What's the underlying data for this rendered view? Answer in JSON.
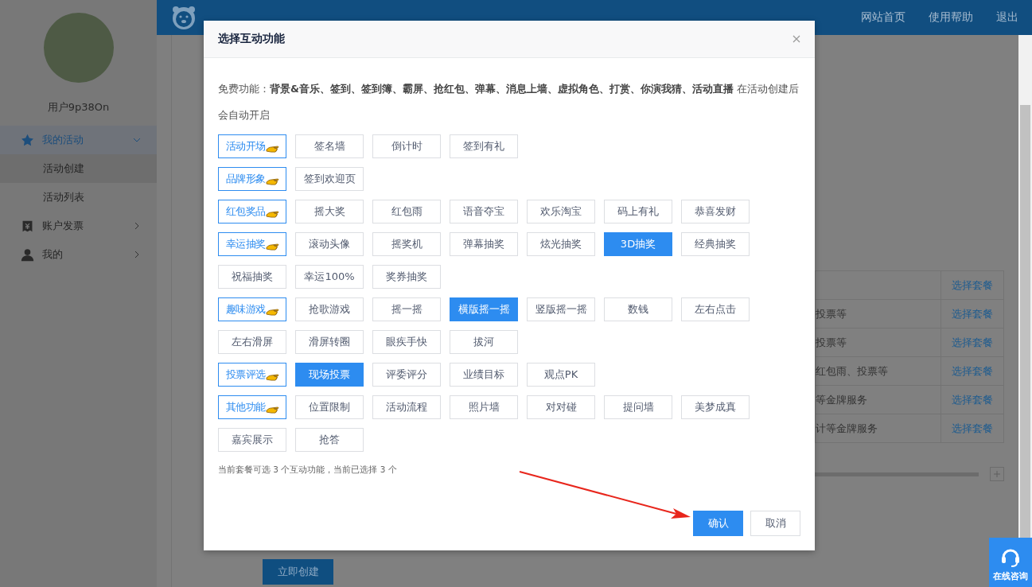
{
  "sidebar": {
    "user_name": "用户9p38On",
    "menu": [
      {
        "label": "我的活动",
        "expanded": true,
        "selected": true,
        "children": [
          {
            "label": "活动创建",
            "selected": true
          },
          {
            "label": "活动列表",
            "selected": false
          }
        ]
      },
      {
        "label": "账户发票",
        "expanded": false,
        "selected": false
      },
      {
        "label": "我的",
        "expanded": false,
        "selected": false
      }
    ]
  },
  "header": {
    "links": [
      "网站首页",
      "使用帮助",
      "退出"
    ]
  },
  "background_table": {
    "rows": [
      {
        "action": "选择套餐"
      },
      {
        "column_1": "投票等",
        "action": "选择套餐"
      },
      {
        "column_1": "投票等",
        "action": "选择套餐"
      },
      {
        "column_1": "红包雨、投票等",
        "action": "选择套餐"
      },
      {
        "column_1": "等金牌服务",
        "action": "选择套餐"
      },
      {
        "column_1": "计等金牌服务",
        "action": "选择套餐"
      }
    ]
  },
  "create_button": "立即创建",
  "dialog": {
    "title": "选择互动功能",
    "free_note": "免费功能：**背景&音乐、签到、签到簿、霸屏、抢红包、弹幕、消息上墙、虚拟角色、打赏、你演我猜、活动直播** 在活动创建后会自动开启",
    "groups": [
      {
        "label": "活动开场",
        "items": [
          {
            "label": "签名墙",
            "selected": false
          },
          {
            "label": "倒计时",
            "selected": false
          },
          {
            "label": "签到有礼",
            "selected": false
          }
        ]
      },
      {
        "label": "品牌形象",
        "items": [
          {
            "label": "签到欢迎页",
            "selected": false
          }
        ]
      },
      {
        "label": "红包奖品",
        "items": [
          {
            "label": "摇大奖",
            "selected": false
          },
          {
            "label": "红包雨",
            "selected": false
          },
          {
            "label": "语音夺宝",
            "selected": false
          },
          {
            "label": "欢乐淘宝",
            "selected": false
          },
          {
            "label": "码上有礼",
            "selected": false
          },
          {
            "label": "恭喜发财",
            "selected": false
          }
        ]
      },
      {
        "label": "幸运抽奖",
        "items": [
          {
            "label": "滚动头像",
            "selected": false
          },
          {
            "label": "摇奖机",
            "selected": false
          },
          {
            "label": "弹幕抽奖",
            "selected": false
          },
          {
            "label": "炫光抽奖",
            "selected": false
          },
          {
            "label": "3D抽奖",
            "selected": true
          },
          {
            "label": "经典抽奖",
            "selected": false
          },
          {
            "label": "祝福抽奖",
            "selected": false
          },
          {
            "label": "幸运100%",
            "selected": false
          },
          {
            "label": "奖券抽奖",
            "selected": false
          }
        ]
      },
      {
        "label": "趣味游戏",
        "items": [
          {
            "label": "抢歌游戏",
            "selected": false
          },
          {
            "label": "摇一摇",
            "selected": false
          },
          {
            "label": "横版摇一摇",
            "selected": true
          },
          {
            "label": "竖版摇一摇",
            "selected": false
          },
          {
            "label": "数钱",
            "selected": false
          },
          {
            "label": "左右点击",
            "selected": false
          },
          {
            "label": "左右滑屏",
            "selected": false
          },
          {
            "label": "滑屏转圈",
            "selected": false
          },
          {
            "label": "眼疾手快",
            "selected": false
          },
          {
            "label": "拔河",
            "selected": false
          }
        ]
      },
      {
        "label": "投票评选",
        "items": [
          {
            "label": "现场投票",
            "selected": true
          },
          {
            "label": "评委评分",
            "selected": false
          },
          {
            "label": "业绩目标",
            "selected": false
          },
          {
            "label": "观点PK",
            "selected": false
          }
        ]
      },
      {
        "label": "其他功能",
        "items": [
          {
            "label": "位置限制",
            "selected": false
          },
          {
            "label": "活动流程",
            "selected": false
          },
          {
            "label": "照片墙",
            "selected": false
          },
          {
            "label": "对对碰",
            "selected": false
          },
          {
            "label": "提问墙",
            "selected": false
          },
          {
            "label": "美梦成真",
            "selected": false
          },
          {
            "label": "嘉宾展示",
            "selected": false
          },
          {
            "label": "抢答",
            "selected": false
          }
        ]
      }
    ],
    "selection_note": "当前套餐可选 3 个互动功能，当前已选择 3 个",
    "confirm": "确认",
    "cancel": "取消"
  },
  "chat_widget": "在线咨询"
}
